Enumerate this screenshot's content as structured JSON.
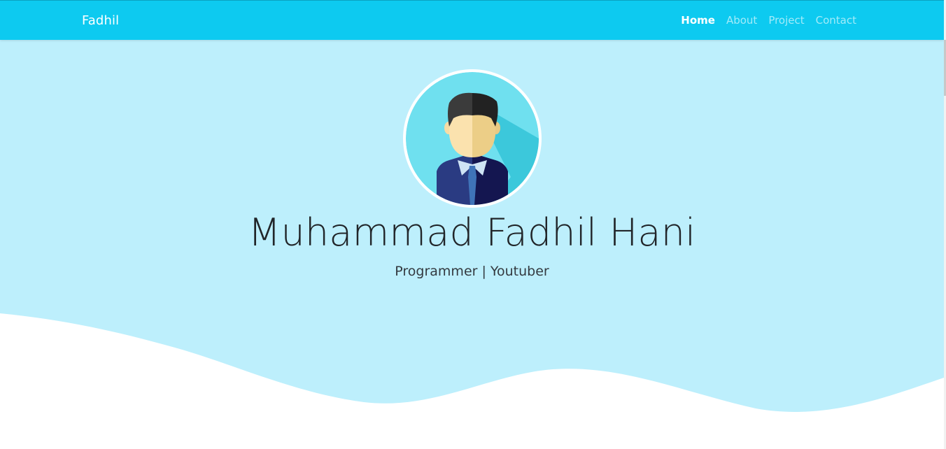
{
  "navbar": {
    "brand": "Fadhil",
    "links": [
      {
        "label": "Home",
        "active": true
      },
      {
        "label": "About",
        "active": false
      },
      {
        "label": "Project",
        "active": false
      },
      {
        "label": "Contact",
        "active": false
      }
    ],
    "background": "#0dcaf0"
  },
  "hero": {
    "name": "Muhammad Fadhil Hani",
    "tagline": "Programmer | Youtuber",
    "background": "#bdeffc",
    "avatar": "male-avatar-illustration"
  }
}
